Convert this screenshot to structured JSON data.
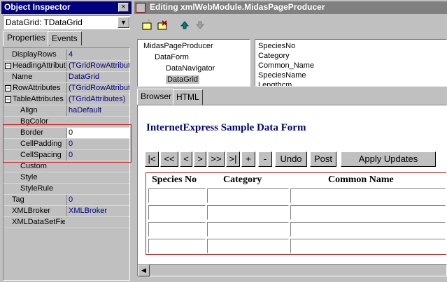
{
  "inspector": {
    "title": "Object Inspector",
    "close_label": "×",
    "object_selector": "DataGrid: TDataGrid",
    "tabs": [
      "Properties",
      "Events"
    ],
    "properties": [
      {
        "name": "DisplayRows",
        "value": "4",
        "expandable": false
      },
      {
        "name": "HeadingAttribut",
        "value": "(TGridRowAttribute",
        "expandable": true
      },
      {
        "name": "Name",
        "value": "DataGrid",
        "expandable": false
      },
      {
        "name": "RowAttributes",
        "value": "(TGridRowAttribute",
        "expandable": true
      },
      {
        "name": "TableAttributes",
        "value": "(TGridAttributes)",
        "expandable": true
      },
      {
        "name": "Align",
        "value": "haDefault",
        "expandable": false
      },
      {
        "name": "BgColor",
        "value": "",
        "expandable": false
      },
      {
        "name": "Border",
        "value": "0",
        "expandable": false
      },
      {
        "name": "CellPadding",
        "value": "0",
        "expandable": false
      },
      {
        "name": "CellSpacing",
        "value": "0",
        "expandable": false
      },
      {
        "name": "Custom",
        "value": "",
        "expandable": false
      },
      {
        "name": "Style",
        "value": "",
        "expandable": false
      },
      {
        "name": "StyleRule",
        "value": "",
        "expandable": false
      },
      {
        "name": "Tag",
        "value": "0",
        "expandable": false
      },
      {
        "name": "XMLBroker",
        "value": "XMLBroker",
        "expandable": false
      },
      {
        "name": "XMLDataSetFie",
        "value": "",
        "expandable": false
      }
    ]
  },
  "editor": {
    "title": "Editing xmlWebModule.MidasPageProducer",
    "tree": [
      "MidasPageProducer",
      "DataForm",
      "DataNavigator",
      "DataGrid"
    ],
    "fields": [
      "SpeciesNo",
      "Category",
      "Common_Name",
      "SpeciesName",
      "Lengthcm"
    ],
    "tabs": [
      "Browser",
      "HTML"
    ],
    "form_title": "InternetExpress Sample Data Form",
    "nav_buttons": [
      "|<",
      "<<",
      "<",
      ">",
      ">>",
      ">|",
      "+",
      "-",
      "Undo",
      "Post",
      "Apply Updates"
    ],
    "grid_headers": [
      "Species No",
      "Category",
      "Common Name"
    ],
    "icons": {
      "new": "new-icon",
      "delete": "delete-icon",
      "up": "arrow-up-icon",
      "down": "arrow-down-icon"
    }
  },
  "colors": {
    "active_title": "#000080",
    "inactive_title": "#808080",
    "highlight": "#d02020"
  }
}
